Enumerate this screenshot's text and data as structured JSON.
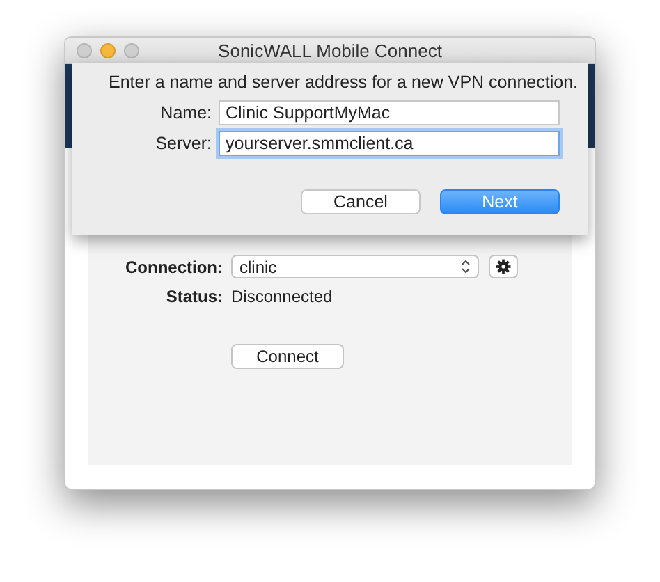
{
  "window": {
    "title": "SonicWALL Mobile Connect"
  },
  "sheet": {
    "prompt": "Enter a name and server address for a new VPN connection.",
    "fields": [
      {
        "label": "Name:",
        "value": "Clinic SupportMyMac",
        "focused": false
      },
      {
        "label": "Server:",
        "value": "yourserver.smmclient.ca",
        "focused": true
      }
    ],
    "buttons": [
      {
        "label": "Cancel",
        "default": false
      },
      {
        "label": "Next",
        "default": true
      }
    ]
  },
  "connection": {
    "label": "Connection:",
    "value": "clinic"
  },
  "status": {
    "label": "Status:",
    "value": "Disconnected"
  },
  "connect_button": "Connect"
}
